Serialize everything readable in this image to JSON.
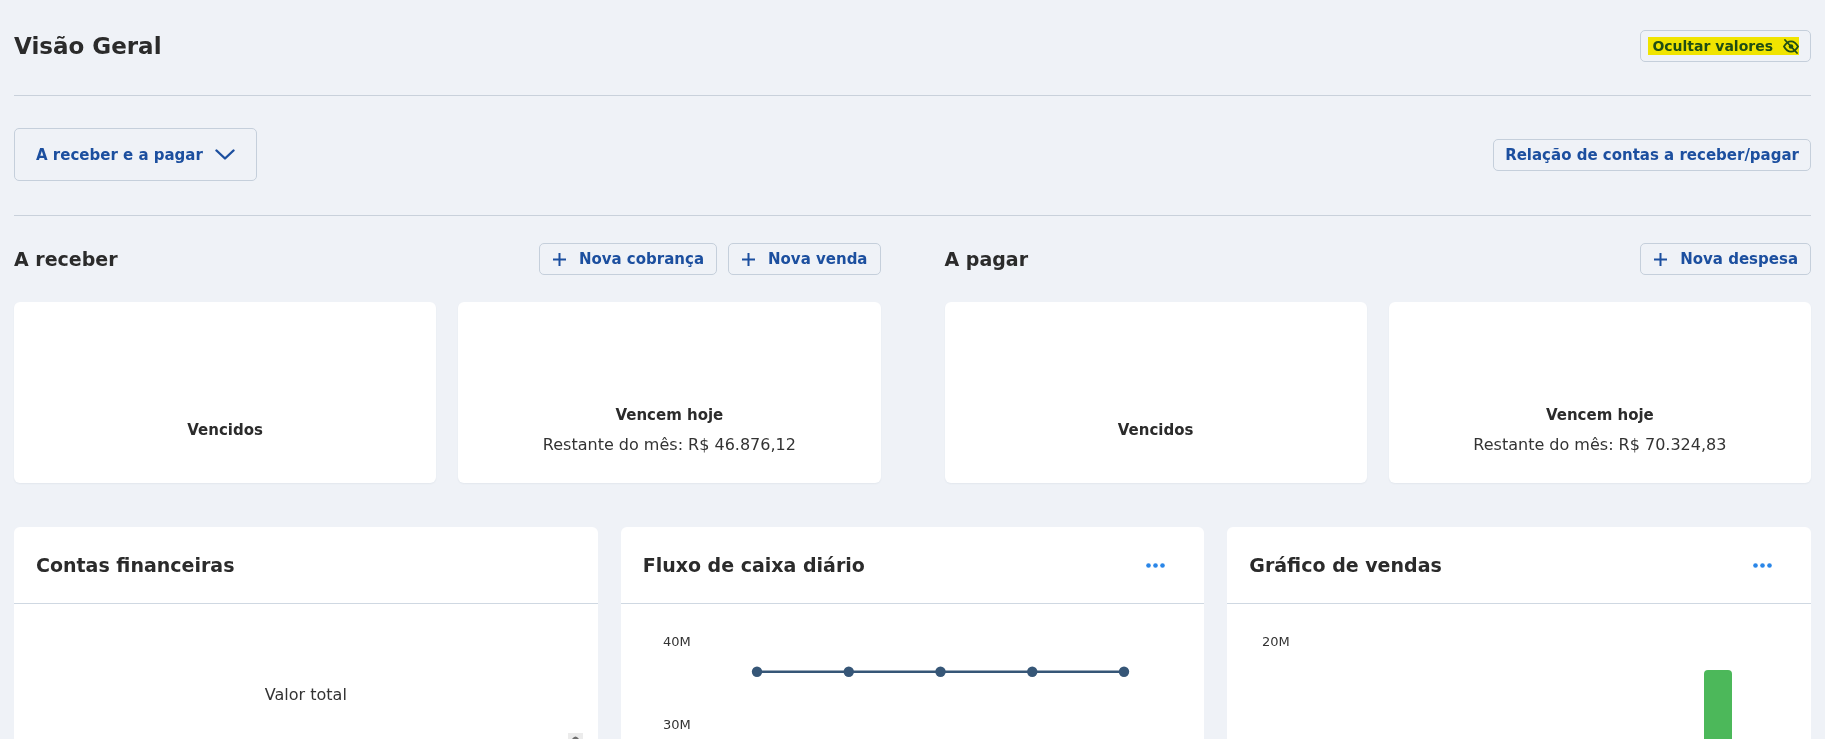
{
  "header": {
    "title": "Visão Geral",
    "hide_values_button": {
      "label": "Ocultar valores",
      "highlighted": true
    }
  },
  "filter": {
    "dropdown": {
      "value": "A receber e a pagar",
      "expanded": false
    },
    "report_button": "Relação de contas a receber/pagar"
  },
  "sections": [
    {
      "title": "A receber",
      "actions": [
        "Nova cobrança",
        "Nova venda"
      ],
      "cards": [
        {
          "title": "Vencidos"
        },
        {
          "title": "Vencem hoje",
          "detail": "Restante do mês: R$ 46.876,12"
        }
      ]
    },
    {
      "title": "A pagar",
      "actions": [
        "Nova despesa"
      ],
      "cards": [
        {
          "title": "Vencidos"
        },
        {
          "title": "Vencem hoje",
          "detail": "Restante do mês: R$ 70.324,83"
        }
      ]
    }
  ],
  "panels": [
    {
      "kind": "accounts",
      "title": "Contas financeiras",
      "menu": false,
      "label": "Valor total"
    },
    {
      "kind": "line_chart",
      "title": "Fluxo de caixa diário",
      "menu": true,
      "chart_data": {
        "type": "line",
        "ylim": [
          30,
          40
        ],
        "yticks": [
          {
            "value": 30,
            "label": "30M"
          },
          {
            "value": 40,
            "label": "40M"
          }
        ],
        "series": [
          {
            "color": "#365677",
            "marker": "circle",
            "values": [
              36.3,
              36.3,
              36.3,
              36.3,
              36.3
            ]
          }
        ]
      }
    },
    {
      "kind": "bar_picture",
      "title": "Gráfico de vendas",
      "menu": true,
      "tick_labels": [
        "20M"
      ]
    }
  ]
}
